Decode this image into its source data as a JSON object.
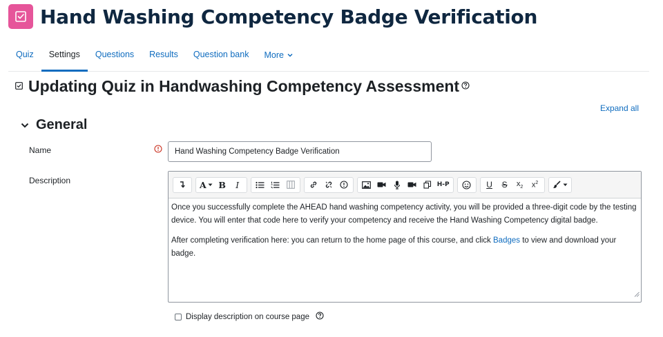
{
  "page": {
    "title": "Hand Washing Competency Badge Verification",
    "activity_icon": "quiz-icon"
  },
  "nav": {
    "tabs": [
      {
        "label": "Quiz",
        "active": false
      },
      {
        "label": "Settings",
        "active": true
      },
      {
        "label": "Questions",
        "active": false
      },
      {
        "label": "Results",
        "active": false
      },
      {
        "label": "Question bank",
        "active": false
      },
      {
        "label": "More",
        "active": false
      }
    ]
  },
  "heading": {
    "text": "Updating Quiz in Handwashing Competency Assessment"
  },
  "expand_all": "Expand all",
  "section": {
    "title": "General"
  },
  "form": {
    "name_label": "Name",
    "name_value": "Hand Washing Competency Badge Verification",
    "description_label": "Description",
    "description_para1": "Once you successfully complete the AHEAD hand washing competency activity, you will be provided a three-digit code by the testing device. You will enter that code here to verify your competency and receive the Hand Washing Competency digital badge.",
    "description_para2_before": "After completing verification here: you can return to the home page of this course, and click ",
    "description_link": "Badges",
    "description_para2_after": " to view and download your badge.",
    "display_checkbox_label": "Display description on course page",
    "display_checkbox_checked": false
  },
  "toolbar": {
    "hp_label": "H-P"
  },
  "colors": {
    "accent": "#0f6cbf",
    "quiz_icon_bg": "#e6559a",
    "title_color": "#0f2740",
    "required": "#ca3120"
  }
}
